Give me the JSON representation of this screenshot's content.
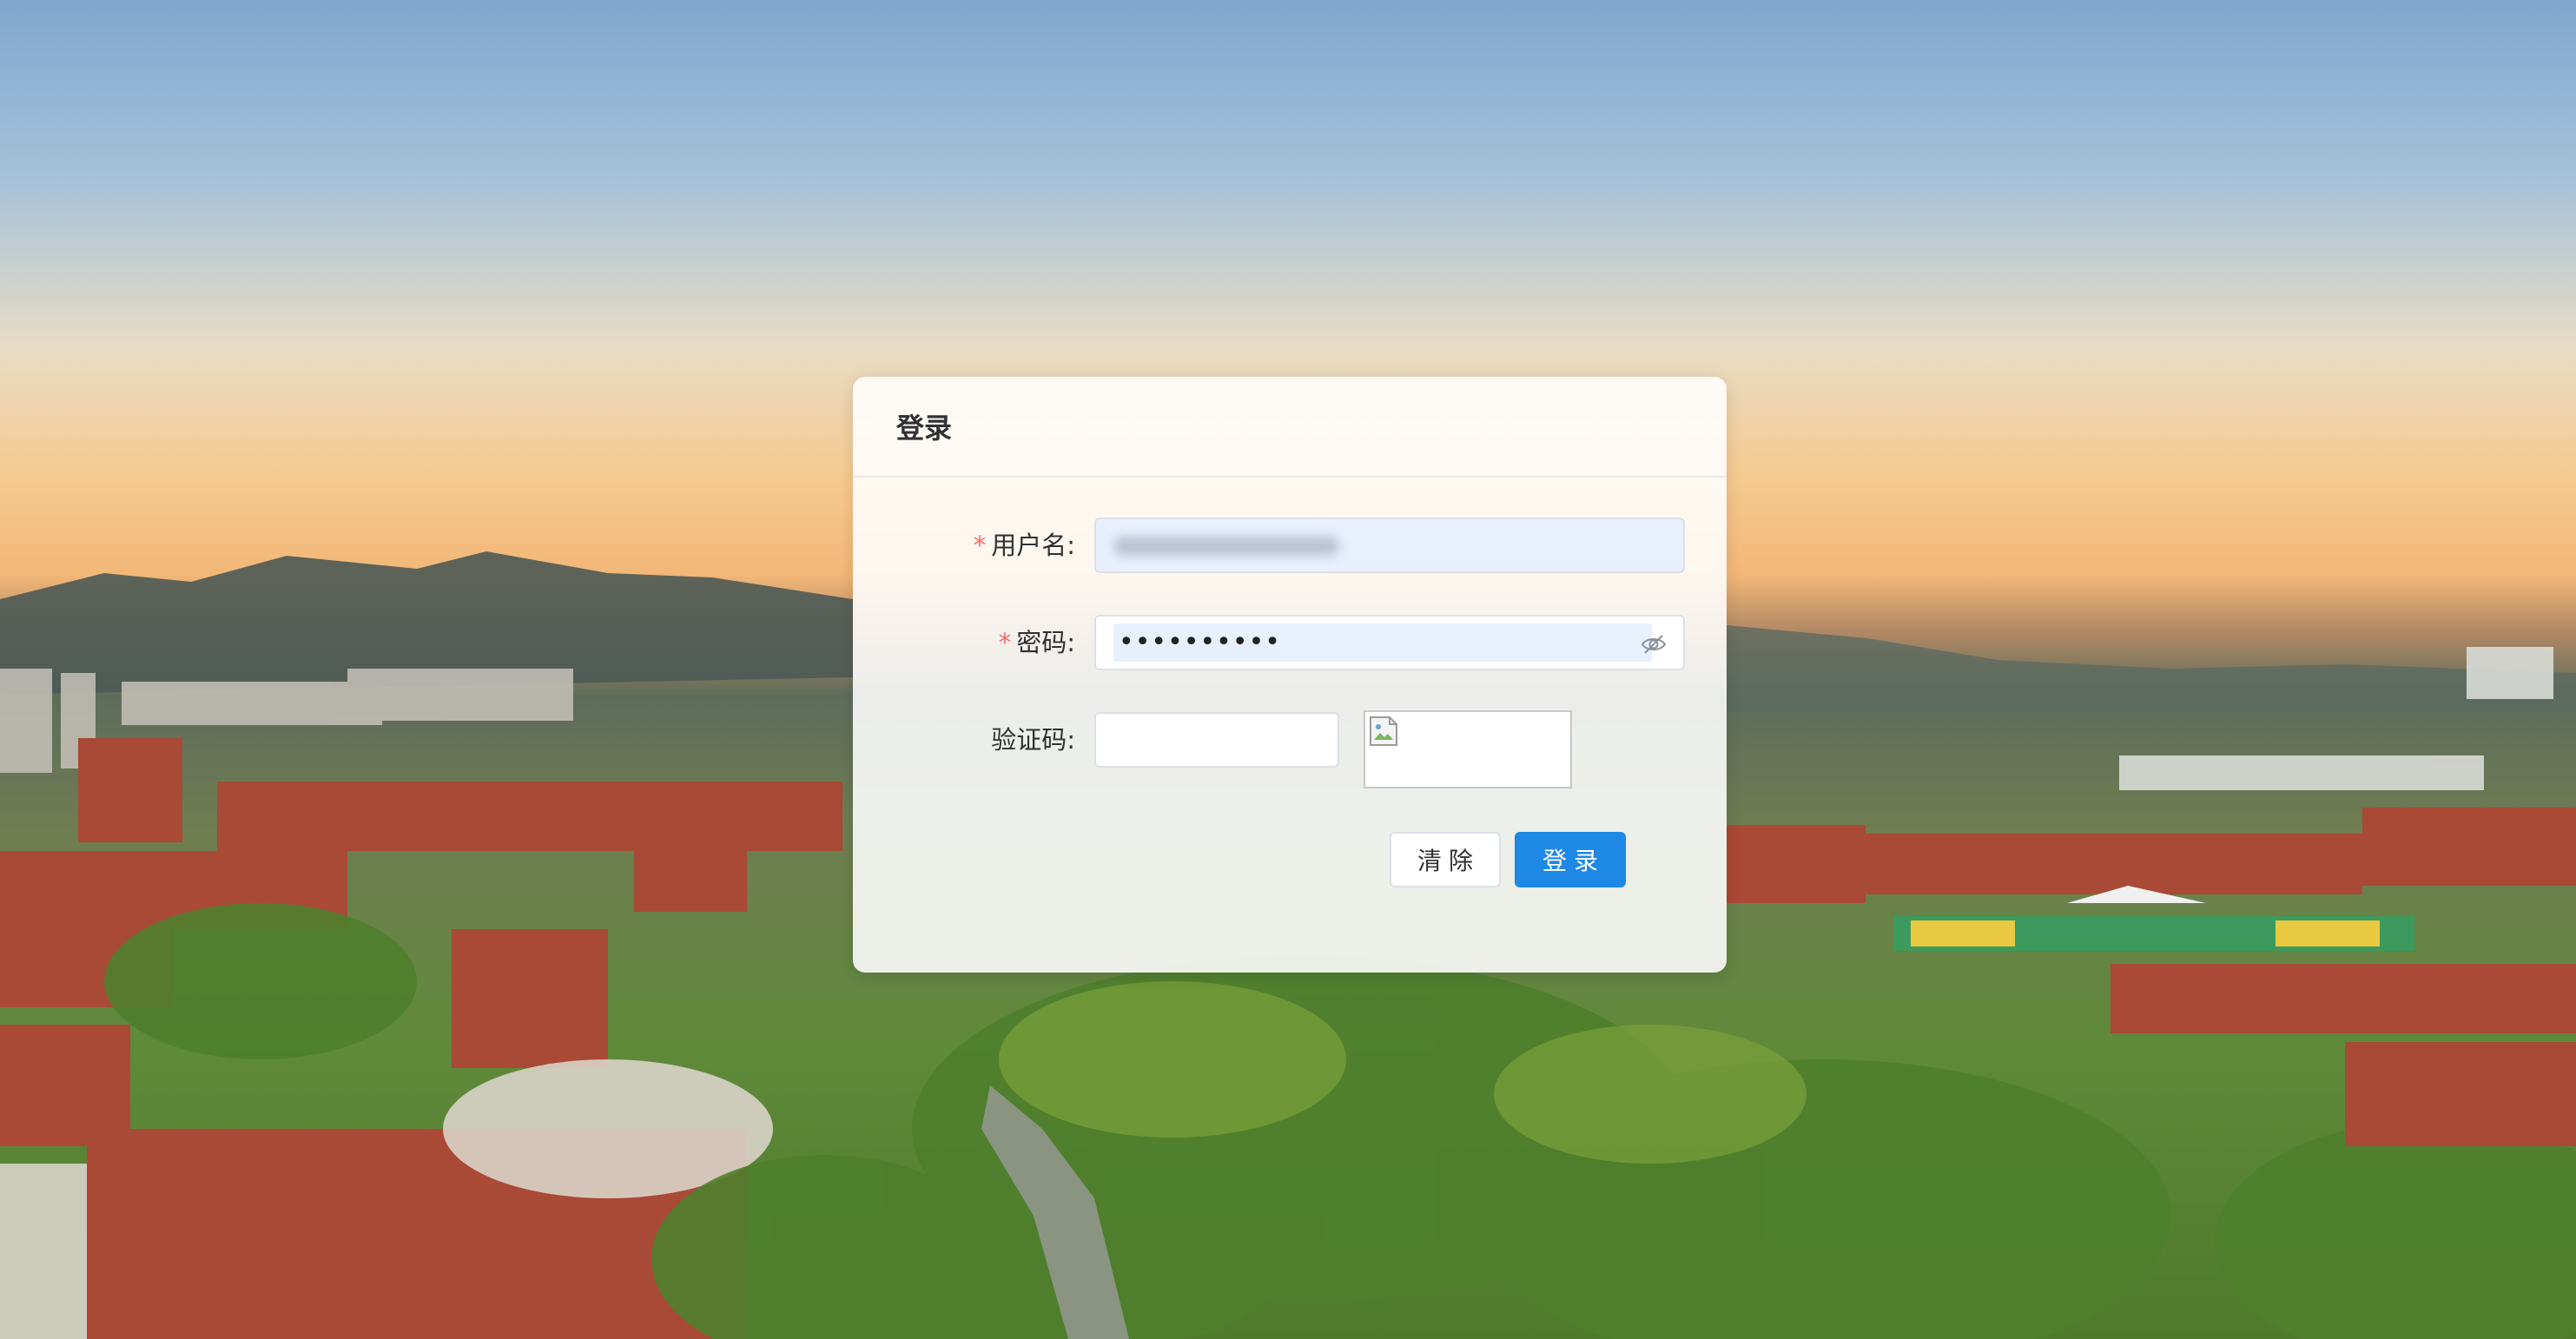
{
  "dialog": {
    "title": "登录"
  },
  "form": {
    "username": {
      "label": "用户名:",
      "required_mark": "*",
      "value": ""
    },
    "password": {
      "label": "密码:",
      "required_mark": "*",
      "value_masked": "••••••••••",
      "toggle_icon": "eye-hidden-icon"
    },
    "captcha": {
      "label": "验证码:",
      "value": "",
      "image_icon": "broken-image-icon"
    }
  },
  "buttons": {
    "clear_label": "清除",
    "login_label": "登录"
  },
  "colors": {
    "primary": "#1e88e5",
    "required": "#f56c6c",
    "autofill_bg": "#e8f0fe"
  }
}
